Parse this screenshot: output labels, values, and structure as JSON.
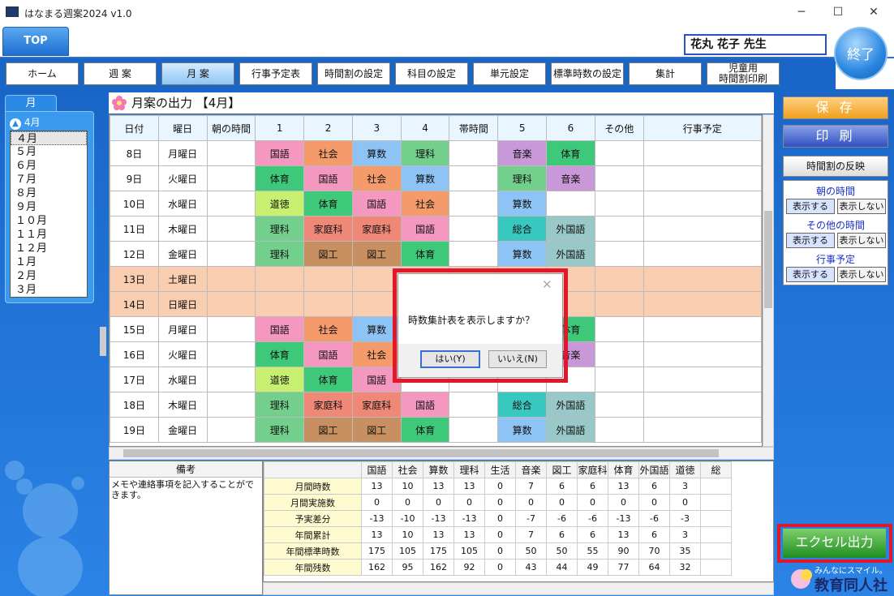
{
  "window": {
    "title": "はなまる週案2024 v1.0",
    "minimize": "─",
    "maximize": "☐",
    "close": "✕"
  },
  "top_tab": "TOP",
  "teacher": "花丸 花子 先生",
  "exit_label": "終了",
  "nav": [
    {
      "label": "ホーム"
    },
    {
      "label": "週 案"
    },
    {
      "label": "月 案",
      "active": true
    },
    {
      "label": "行事予定表"
    },
    {
      "label": "時間割の設定"
    },
    {
      "label": "科目の設定"
    },
    {
      "label": "単元設定"
    },
    {
      "label": "標準時数の設定"
    },
    {
      "label": "集計"
    },
    {
      "label": "児童用\n時間割印刷"
    }
  ],
  "month_panel": {
    "tab": "月",
    "current": "4月",
    "months": [
      "４月",
      "５月",
      "６月",
      "７月",
      "８月",
      "９月",
      "１０月",
      "１１月",
      "１２月",
      "１月",
      "２月",
      "３月"
    ]
  },
  "content_title": "月案の出力 【4月】",
  "grid": {
    "headers": [
      "日付",
      "曜日",
      "朝の時間",
      "1",
      "2",
      "3",
      "4",
      "帯時間",
      "5",
      "6",
      "その他",
      "行事予定"
    ],
    "rows": [
      {
        "date": "8日",
        "dow": "月曜日",
        "p": [
          "国語",
          "社会",
          "算数",
          "理科",
          "",
          "音楽",
          "体育"
        ]
      },
      {
        "date": "9日",
        "dow": "火曜日",
        "p": [
          "体育",
          "国語",
          "社会",
          "算数",
          "",
          "理科",
          "音楽"
        ]
      },
      {
        "date": "10日",
        "dow": "水曜日",
        "p": [
          "道徳",
          "体育",
          "国語",
          "社会",
          "",
          "算数",
          ""
        ]
      },
      {
        "date": "11日",
        "dow": "木曜日",
        "p": [
          "理科",
          "家庭科",
          "家庭科",
          "国語",
          "",
          "総合",
          "外国語"
        ]
      },
      {
        "date": "12日",
        "dow": "金曜日",
        "p": [
          "理科",
          "図工",
          "図工",
          "体育",
          "",
          "算数",
          "外国語"
        ]
      },
      {
        "date": "13日",
        "dow": "土曜日",
        "weekend": true,
        "p": [
          "",
          "",
          "",
          "",
          "",
          "",
          ""
        ]
      },
      {
        "date": "14日",
        "dow": "日曜日",
        "weekend": true,
        "p": [
          "",
          "",
          "",
          "",
          "",
          "",
          ""
        ]
      },
      {
        "date": "15日",
        "dow": "月曜日",
        "p": [
          "国語",
          "社会",
          "算数",
          "",
          "",
          "",
          "体育"
        ]
      },
      {
        "date": "16日",
        "dow": "火曜日",
        "p": [
          "体育",
          "国語",
          "社会",
          "",
          "",
          "",
          "音楽"
        ]
      },
      {
        "date": "17日",
        "dow": "水曜日",
        "p": [
          "道徳",
          "体育",
          "国語",
          "",
          "",
          "",
          ""
        ]
      },
      {
        "date": "18日",
        "dow": "木曜日",
        "p": [
          "理科",
          "家庭科",
          "家庭科",
          "国語",
          "",
          "総合",
          "外国語"
        ]
      },
      {
        "date": "19日",
        "dow": "金曜日",
        "p": [
          "理科",
          "図工",
          "図工",
          "体育",
          "",
          "算数",
          "外国語"
        ]
      }
    ]
  },
  "subject_colors": {
    "国語": "#f598c0",
    "社会": "#f59a6a",
    "算数": "#8ec4f5",
    "理科": "#72cf8c",
    "体育": "#3ec87a",
    "音楽": "#c898d8",
    "道徳": "#c8f070",
    "家庭科": "#f08878",
    "総合": "#38c8c0",
    "外国語": "#98c8c8",
    "図工": "#c89060"
  },
  "remarks": {
    "header": "備考",
    "text": "メモや連絡事項を記入することができます。"
  },
  "summary": {
    "subjects": [
      "国語",
      "社会",
      "算数",
      "理科",
      "生活",
      "音楽",
      "図工",
      "家庭科",
      "体育",
      "外国語",
      "道徳",
      "総"
    ],
    "rows": [
      {
        "label": "月間時数",
        "values": [
          "13",
          "10",
          "13",
          "13",
          "0",
          "7",
          "6",
          "6",
          "13",
          "6",
          "3",
          ""
        ]
      },
      {
        "label": "月間実施数",
        "values": [
          "0",
          "0",
          "0",
          "0",
          "0",
          "0",
          "0",
          "0",
          "0",
          "0",
          "0",
          ""
        ]
      },
      {
        "label": "予実差分",
        "values": [
          "-13",
          "-10",
          "-13",
          "-13",
          "0",
          "-7",
          "-6",
          "-6",
          "-13",
          "-6",
          "-3",
          ""
        ]
      },
      {
        "label": "年間累計",
        "values": [
          "13",
          "10",
          "13",
          "13",
          "0",
          "7",
          "6",
          "6",
          "13",
          "6",
          "3",
          ""
        ]
      },
      {
        "label": "年間標準時数",
        "values": [
          "175",
          "105",
          "175",
          "105",
          "0",
          "50",
          "50",
          "55",
          "90",
          "70",
          "35",
          ""
        ]
      },
      {
        "label": "年間残数",
        "values": [
          "162",
          "95",
          "162",
          "92",
          "0",
          "43",
          "44",
          "49",
          "77",
          "64",
          "32",
          ""
        ]
      }
    ]
  },
  "right": {
    "save": "保 存",
    "print": "印 刷",
    "reflect": "時間割の反映",
    "morning_label": "朝の時間",
    "other_label": "その他の時間",
    "event_label": "行事予定",
    "show": "表示する",
    "hide": "表示しない",
    "excel": "エクセル出力"
  },
  "logo": {
    "small": "みんなにスマイル。",
    "name": "教育同人社"
  },
  "dialog": {
    "close": "✕",
    "message": "時数集計表を表示しますか？",
    "yes": "はい(Y)",
    "no": "いいえ(N)"
  },
  "colors": {
    "highlight": "#e0182a",
    "accent": "#1a66c8",
    "weekend": "#f8cdb0"
  }
}
